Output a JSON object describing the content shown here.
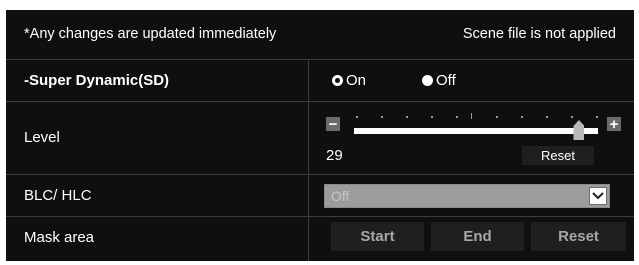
{
  "header": {
    "notice": "*Any changes are updated immediately",
    "scene_status": "Scene file is not applied"
  },
  "super_dynamic": {
    "label": "-Super Dynamic(SD)",
    "options": [
      "On",
      "Off"
    ],
    "selected": "On"
  },
  "level": {
    "label": "Level",
    "value": "29",
    "minus": "−",
    "plus": "+",
    "reset_label": "Reset",
    "slider_fraction": 0.92
  },
  "blc_hlc": {
    "label": "BLC/ HLC",
    "value": "Off"
  },
  "mask_area": {
    "label": "Mask area",
    "start_label": "Start",
    "end_label": "End",
    "reset_label": "Reset"
  },
  "colors": {
    "panel": "#0f0f0f",
    "divider": "#3c3c3c",
    "button": "#1f1f1f",
    "disabled_select": "#9c9c9c"
  }
}
